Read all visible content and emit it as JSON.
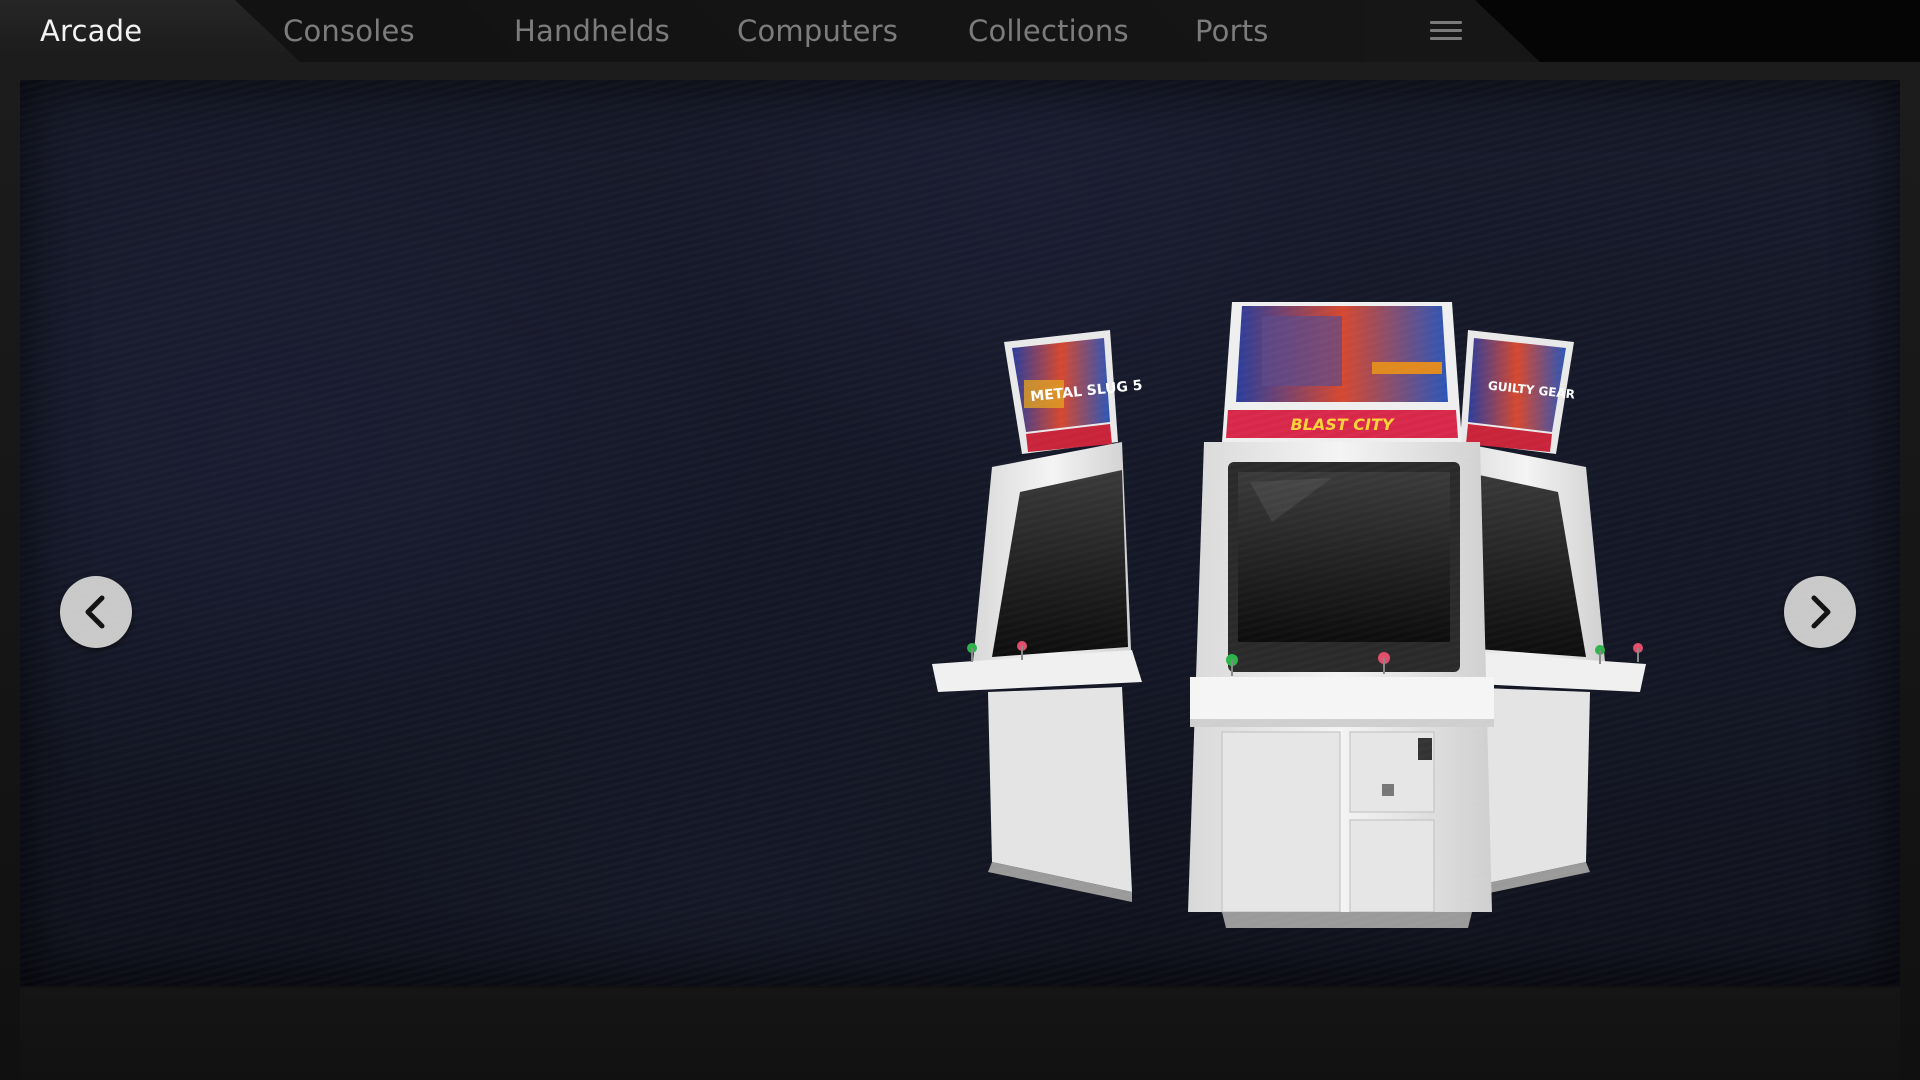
{
  "tabs": [
    {
      "label": "Arcade",
      "active": true
    },
    {
      "label": "Consoles",
      "active": false
    },
    {
      "label": "Handhelds",
      "active": false
    },
    {
      "label": "Computers",
      "active": false
    },
    {
      "label": "Collections",
      "active": false
    },
    {
      "label": "Ports",
      "active": false
    }
  ],
  "menu": {
    "icon": "hamburger-menu-icon"
  },
  "hero": {
    "image": "sega-blast-city-arcade-cabinets",
    "left_marquee": "METAL SLUG 5",
    "center_marquee": "BLAST CITY",
    "right_marquee": "GUILTY GEAR",
    "cabinet_brand": "BLAST CITY"
  },
  "navigation": {
    "prev_icon": "chevron-left-icon",
    "next_icon": "chevron-right-icon"
  },
  "colors": {
    "active_tab_text": "#f2f2f2",
    "inactive_tab_text": "#7c7c7c",
    "background": "#141726",
    "nav_button": "#c9c9c9"
  }
}
